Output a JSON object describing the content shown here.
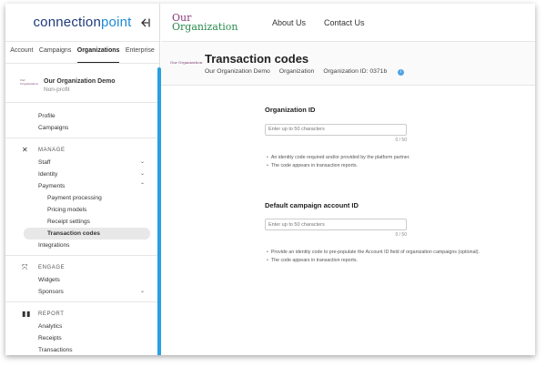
{
  "sidebar": {
    "logo": {
      "part1": "connection",
      "part2": "point"
    },
    "tabs": [
      {
        "label": "Account"
      },
      {
        "label": "Campaigns"
      },
      {
        "label": "Organizations"
      },
      {
        "label": "Enterprise"
      }
    ],
    "org": {
      "avatar_text": "Our Organization",
      "name": "Our Organization Demo",
      "type": "Non-profit"
    },
    "top_items": [
      {
        "label": "Profile"
      },
      {
        "label": "Campaigns"
      }
    ],
    "manage": {
      "heading": "MANAGE",
      "items": [
        {
          "label": "Staff",
          "chevron": "⌄"
        },
        {
          "label": "Identity",
          "chevron": "⌄"
        },
        {
          "label": "Payments",
          "chevron": "⌃"
        }
      ],
      "payment_sub": [
        {
          "label": "Payment processing"
        },
        {
          "label": "Pricing models"
        },
        {
          "label": "Receipt settings"
        },
        {
          "label": "Transaction codes"
        }
      ],
      "after": [
        {
          "label": "Integrations"
        }
      ]
    },
    "engage": {
      "heading": "ENGAGE",
      "items": [
        {
          "label": "Widgets",
          "chevron": ""
        },
        {
          "label": "Sponsors",
          "chevron": "⌄"
        }
      ]
    },
    "report": {
      "heading": "REPORT",
      "items": [
        {
          "label": "Analytics"
        },
        {
          "label": "Receipts"
        },
        {
          "label": "Transactions"
        }
      ]
    }
  },
  "topnav": {
    "brand_line1": "Our",
    "brand_line2": "Organization",
    "links": [
      {
        "label": "About Us"
      },
      {
        "label": "Contact Us"
      }
    ]
  },
  "page": {
    "avatar_text": "Our Organization",
    "title": "Transaction codes",
    "breadcrumbs": [
      "Our Organization Demo",
      "Organization"
    ],
    "org_id_label": "Organization ID: 0371b",
    "info_icon": "i"
  },
  "fields": [
    {
      "label": "Organization ID",
      "placeholder": "Enter up to 50 characters",
      "counter": "0 / 50",
      "bullets": [
        "An identity code required and/or provided by the platform partner.",
        "The code appears in transaction reports."
      ]
    },
    {
      "label": "Default campaign account ID",
      "placeholder": "Enter up to 50 characters",
      "counter": "0 / 50",
      "bullets": [
        "Provide an identity code to pre-populate the Account ID field of organization campaigns (optional).",
        "The code appears in transaction reports."
      ]
    }
  ],
  "colors": {
    "accent": "#2b9fe0",
    "brand_purple": "#8b3d7c",
    "brand_green": "#2b8a4d",
    "logo_blue": "#1f3a7a"
  }
}
